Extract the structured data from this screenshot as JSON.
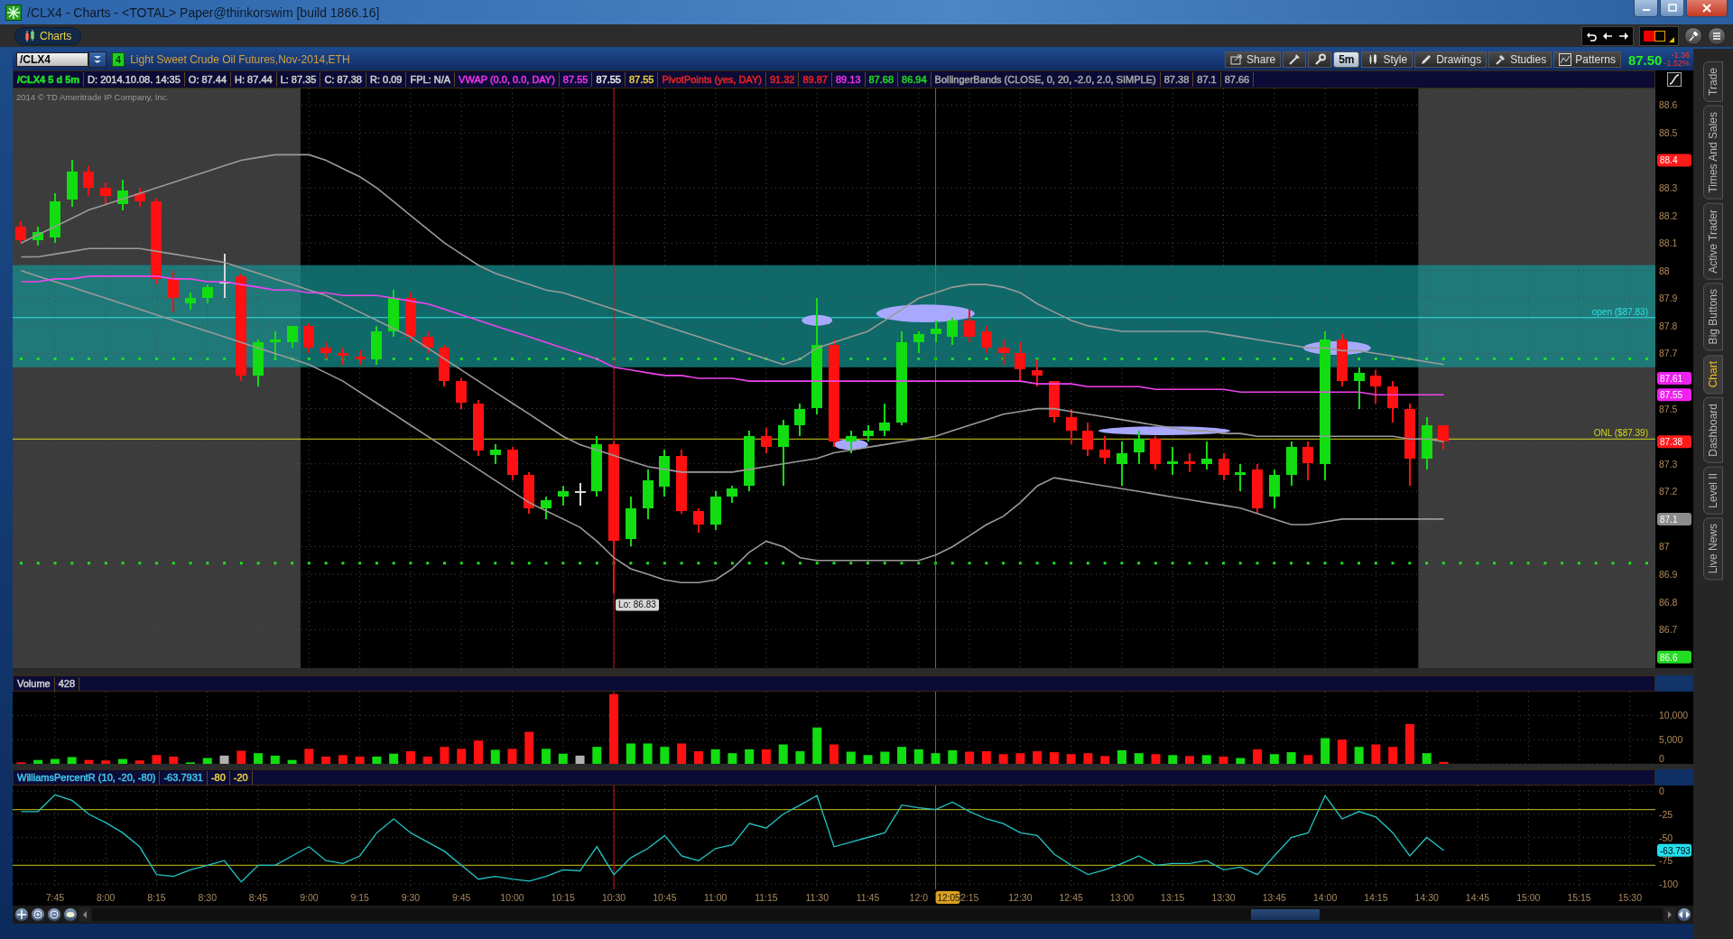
{
  "window": {
    "title": "/CLX4 - Charts - <TOTAL> Paper@thinkorswim [build 1866.16]"
  },
  "app_tabs": [
    {
      "label": "Charts",
      "selected": true
    }
  ],
  "symbol_bar": {
    "symbol": "/CLX4",
    "badge": "4",
    "description": "Light Sweet Crude Oil Futures,Nov-2014,ETH",
    "last_price": "87.50",
    "change": "-1.36",
    "change_percent": "-1.52%",
    "toolbar": [
      {
        "kind": "button",
        "label": "Share"
      },
      {
        "kind": "icon"
      },
      {
        "kind": "icon"
      },
      {
        "kind": "interval",
        "label": "5m"
      },
      {
        "kind": "button",
        "label": "Style"
      },
      {
        "kind": "button",
        "label": "Drawings"
      },
      {
        "kind": "button",
        "label": "Studies"
      },
      {
        "kind": "button",
        "label": "Patterns"
      }
    ]
  },
  "info_bar": {
    "cells": [
      {
        "text": "/CLX4 5 d 5m",
        "color": "#22dd22"
      },
      {
        "text": "D: 2014.10.08. 14:35",
        "color": "#d0d0d0"
      },
      {
        "text": "O: 87.44",
        "color": "#d0d0d0"
      },
      {
        "text": "H: 87.44",
        "color": "#d0d0d0"
      },
      {
        "text": "L: 87.35",
        "color": "#d0d0d0"
      },
      {
        "text": "C: 87.38",
        "color": "#d0d0d0"
      },
      {
        "text": "R: 0.09",
        "color": "#d0d0d0"
      },
      {
        "text": "FPL: N/A",
        "color": "#d0d0d0"
      },
      {
        "text": "VWAP (0.0, 0.0, DAY)",
        "color": "#ee33ee"
      },
      {
        "text": "87.55",
        "color": "#ee33ee"
      },
      {
        "text": "87.55",
        "color": "#e8e8e8"
      },
      {
        "text": "87.55",
        "color": "#e8d040"
      },
      {
        "text": "PivotPoints (yes, DAY)",
        "color": "#ee2222"
      },
      {
        "text": "91.32",
        "color": "#ee2222"
      },
      {
        "text": "89.87",
        "color": "#ee2222"
      },
      {
        "text": "89.13",
        "color": "#ee33ee"
      },
      {
        "text": "87.68",
        "color": "#22dd22"
      },
      {
        "text": "86.94",
        "color": "#22dd22"
      },
      {
        "text": "BollingerBands (CLOSE, 0, 20, -2.0, 2.0, SIMPLE)",
        "color": "#a8a8a8"
      },
      {
        "text": "87.38",
        "color": "#a8a8a8"
      },
      {
        "text": "87.1",
        "color": "#a8a8a8"
      },
      {
        "text": "87.66",
        "color": "#a8a8a8"
      }
    ]
  },
  "price_pane": {
    "copyright": "2014 © TD Ameritrade IP Company, Inc.",
    "extended_hours_shaded": true,
    "drawings": [
      {
        "kind": "ellipse"
      },
      {
        "kind": "ellipse"
      },
      {
        "kind": "ellipse"
      },
      {
        "kind": "ellipse"
      },
      {
        "kind": "ellipse"
      }
    ],
    "axis_tags": [
      {
        "label": "88.4",
        "color": "#ff1a1a"
      },
      {
        "label": "87.61",
        "color": "#ee22ee"
      },
      {
        "label": "87.55",
        "color": "#ee22ee"
      },
      {
        "label": "87.38",
        "color": "#ff1a1a"
      },
      {
        "label": "87.1",
        "color": "#8c8c8c"
      },
      {
        "label": "86.6",
        "color": "#22dd22"
      }
    ],
    "chart_data": {
      "type": "candlestick",
      "grid": true,
      "ylim": [
        86.56,
        88.66
      ],
      "yticks": [
        88.6,
        88.5,
        88.3,
        88.2,
        88.1,
        88,
        87.9,
        87.8,
        87.7,
        87.5,
        87.3,
        87.2,
        87,
        86.9,
        86.8,
        86.7
      ],
      "categories": [
        null,
        null,
        null,
        null,
        null,
        null,
        null,
        null,
        null,
        null,
        null,
        null,
        null,
        null,
        null,
        null,
        null,
        null,
        null,
        null,
        null,
        null,
        null,
        null,
        null,
        null,
        null,
        null,
        null,
        null,
        null,
        null,
        null,
        null,
        null,
        null,
        null,
        null,
        null,
        null,
        null,
        null,
        null,
        null,
        null,
        null,
        null,
        null,
        null,
        null,
        null,
        null,
        null,
        null,
        null,
        null,
        null,
        null,
        null,
        null,
        null,
        null,
        null,
        null,
        null,
        null,
        null,
        null,
        null,
        null,
        null,
        null,
        null,
        null,
        null,
        null,
        null,
        null,
        null,
        null,
        null,
        null,
        null,
        null,
        null,
        null,
        null,
        null,
        null,
        null,
        null,
        null,
        null,
        null,
        null,
        null,
        null
      ],
      "ohlc": [
        [
          88.16,
          88.18,
          88.1,
          88.11
        ],
        [
          88.11,
          88.16,
          88.09,
          88.14
        ],
        [
          88.12,
          88.28,
          88.1,
          88.25
        ],
        [
          88.26,
          88.4,
          88.23,
          88.36
        ],
        [
          88.36,
          88.38,
          88.27,
          88.3
        ],
        [
          88.3,
          88.32,
          88.24,
          88.27
        ],
        [
          88.24,
          88.33,
          88.22,
          88.29
        ],
        [
          88.28,
          88.3,
          88.23,
          88.25
        ],
        [
          88.25,
          88.26,
          87.95,
          87.97
        ],
        [
          87.97,
          88.0,
          87.85,
          87.9
        ],
        [
          87.88,
          87.92,
          87.86,
          87.9
        ],
        [
          87.9,
          87.95,
          87.88,
          87.94
        ],
        [
          87.96,
          88.06,
          87.9,
          87.96
        ],
        [
          87.98,
          87.99,
          87.6,
          87.62
        ],
        [
          87.62,
          87.75,
          87.58,
          87.74
        ],
        [
          87.74,
          87.78,
          87.68,
          87.75
        ],
        [
          87.74,
          87.8,
          87.72,
          87.8
        ],
        [
          87.8,
          87.81,
          87.7,
          87.72
        ],
        [
          87.72,
          87.74,
          87.68,
          87.7
        ],
        [
          87.7,
          87.72,
          87.66,
          87.69
        ],
        [
          87.69,
          87.71,
          87.66,
          87.68
        ],
        [
          87.68,
          87.8,
          87.66,
          87.78
        ],
        [
          87.78,
          87.93,
          87.76,
          87.9
        ],
        [
          87.9,
          87.92,
          87.74,
          87.76
        ],
        [
          87.76,
          87.78,
          87.7,
          87.72
        ],
        [
          87.72,
          87.73,
          87.58,
          87.6
        ],
        [
          87.6,
          87.61,
          87.5,
          87.52
        ],
        [
          87.52,
          87.53,
          87.33,
          87.35
        ],
        [
          87.33,
          87.37,
          87.3,
          87.35
        ],
        [
          87.35,
          87.36,
          87.24,
          87.26
        ],
        [
          87.26,
          87.27,
          87.12,
          87.14
        ],
        [
          87.14,
          87.18,
          87.1,
          87.17
        ],
        [
          87.18,
          87.22,
          87.15,
          87.2
        ],
        [
          87.2,
          87.23,
          87.15,
          87.2
        ],
        [
          87.2,
          87.4,
          87.18,
          87.37
        ],
        [
          87.37,
          87.38,
          86.83,
          87.02
        ],
        [
          87.03,
          87.18,
          87.0,
          87.14
        ],
        [
          87.14,
          87.28,
          87.1,
          87.24
        ],
        [
          87.22,
          87.35,
          87.18,
          87.33
        ],
        [
          87.33,
          87.35,
          87.12,
          87.13
        ],
        [
          87.13,
          87.14,
          87.05,
          87.08
        ],
        [
          87.08,
          87.2,
          87.06,
          87.18
        ],
        [
          87.18,
          87.22,
          87.16,
          87.21
        ],
        [
          87.22,
          87.42,
          87.2,
          87.4
        ],
        [
          87.4,
          87.43,
          87.34,
          87.36
        ],
        [
          87.36,
          87.46,
          87.22,
          87.44
        ],
        [
          87.44,
          87.52,
          87.4,
          87.5
        ],
        [
          87.5,
          87.9,
          87.48,
          87.73
        ],
        [
          87.73,
          87.75,
          87.36,
          87.38
        ],
        [
          87.38,
          87.42,
          87.34,
          87.4
        ],
        [
          87.4,
          87.44,
          87.38,
          87.42
        ],
        [
          87.42,
          87.52,
          87.4,
          87.45
        ],
        [
          87.45,
          87.78,
          87.44,
          87.74
        ],
        [
          87.74,
          87.78,
          87.7,
          87.77
        ],
        [
          87.77,
          87.82,
          87.74,
          87.79
        ],
        [
          87.76,
          87.83,
          87.73,
          87.82
        ],
        [
          87.82,
          87.86,
          87.74,
          87.76
        ],
        [
          87.78,
          87.8,
          87.7,
          87.72
        ],
        [
          87.72,
          87.75,
          87.66,
          87.7
        ],
        [
          87.7,
          87.74,
          87.6,
          87.64
        ],
        [
          87.64,
          87.68,
          87.58,
          87.62
        ],
        [
          87.6,
          87.6,
          87.45,
          87.47
        ],
        [
          87.47,
          87.5,
          87.37,
          87.42
        ],
        [
          87.42,
          87.45,
          87.33,
          87.35
        ],
        [
          87.35,
          87.4,
          87.3,
          87.32
        ],
        [
          87.3,
          87.38,
          87.22,
          87.34
        ],
        [
          87.34,
          87.42,
          87.3,
          87.39
        ],
        [
          87.39,
          87.4,
          87.28,
          87.3
        ],
        [
          87.3,
          87.36,
          87.26,
          87.31
        ],
        [
          87.31,
          87.34,
          87.27,
          87.3
        ],
        [
          87.3,
          87.38,
          87.28,
          87.32
        ],
        [
          87.32,
          87.34,
          87.24,
          87.26
        ],
        [
          87.26,
          87.3,
          87.2,
          87.27
        ],
        [
          87.28,
          87.3,
          87.12,
          87.14
        ],
        [
          87.18,
          87.28,
          87.14,
          87.26
        ],
        [
          87.26,
          87.38,
          87.22,
          87.36
        ],
        [
          87.36,
          87.38,
          87.24,
          87.3
        ],
        [
          87.3,
          87.78,
          87.24,
          87.75
        ],
        [
          87.75,
          87.77,
          87.58,
          87.6
        ],
        [
          87.6,
          87.65,
          87.5,
          87.63
        ],
        [
          87.62,
          87.64,
          87.52,
          87.58
        ],
        [
          87.58,
          87.6,
          87.45,
          87.5
        ],
        [
          87.5,
          87.52,
          87.22,
          87.32
        ],
        [
          87.32,
          87.47,
          87.28,
          87.44
        ],
        [
          87.44,
          87.44,
          87.35,
          87.38
        ],
        null,
        null,
        null,
        null,
        null,
        null,
        null,
        null,
        null,
        null,
        null,
        null
      ],
      "series": [
        {
          "type": "line",
          "color": "#ee44ee",
          "values": [
            87.96,
            87.96,
            87.97,
            87.97,
            87.98,
            87.98,
            87.98,
            87.98,
            87.98,
            87.97,
            87.97,
            87.96,
            87.96,
            87.95,
            87.94,
            87.93,
            87.93,
            87.92,
            87.92,
            87.91,
            87.91,
            87.91,
            87.9,
            87.89,
            87.88,
            87.86,
            87.84,
            87.82,
            87.8,
            87.78,
            87.76,
            87.74,
            87.72,
            87.7,
            87.68,
            87.65,
            87.64,
            87.63,
            87.62,
            87.62,
            87.61,
            87.61,
            87.61,
            87.6,
            87.6,
            87.6,
            87.6,
            87.6,
            87.6,
            87.6,
            87.6,
            87.6,
            87.6,
            87.6,
            87.6,
            87.6,
            87.6,
            87.6,
            87.6,
            87.6,
            87.59,
            87.59,
            87.59,
            87.58,
            87.58,
            87.58,
            87.58,
            87.57,
            87.57,
            87.57,
            87.57,
            87.57,
            87.56,
            87.56,
            87.56,
            87.56,
            87.56,
            87.56,
            87.56,
            87.56,
            87.55,
            87.55,
            87.55,
            87.55,
            87.55,
            null,
            null,
            null,
            null,
            null,
            null,
            null,
            null,
            null,
            null,
            null,
            null
          ]
        },
        {
          "type": "line",
          "color": "#9a9a9a",
          "values": [
            88.1,
            88.13,
            88.16,
            88.19,
            88.22,
            88.24,
            88.26,
            88.28,
            88.3,
            88.32,
            88.34,
            88.36,
            88.38,
            88.4,
            88.41,
            88.42,
            88.42,
            88.42,
            88.4,
            88.37,
            88.34,
            88.3,
            88.25,
            88.2,
            88.15,
            88.1,
            88.06,
            88.02,
            87.99,
            87.97,
            87.95,
            87.93,
            87.92,
            87.9,
            87.88,
            87.86,
            87.84,
            87.82,
            87.8,
            87.78,
            87.76,
            87.74,
            87.72,
            87.7,
            87.68,
            87.66,
            87.68,
            87.72,
            87.74,
            87.76,
            87.78,
            87.82,
            87.86,
            87.9,
            87.92,
            87.94,
            87.95,
            87.95,
            87.94,
            87.92,
            87.88,
            87.85,
            87.82,
            87.8,
            87.79,
            87.78,
            87.78,
            87.78,
            87.78,
            87.78,
            87.78,
            87.77,
            87.76,
            87.75,
            87.74,
            87.73,
            87.72,
            87.72,
            87.71,
            87.71,
            87.7,
            87.69,
            87.68,
            87.67,
            87.66,
            null,
            null,
            null,
            null,
            null,
            null,
            null,
            null,
            null,
            null,
            null,
            null
          ]
        },
        {
          "type": "line",
          "color": "#9a9a9a",
          "values": [
            88.05,
            88.05,
            88.06,
            88.07,
            88.08,
            88.08,
            88.08,
            88.08,
            88.07,
            88.06,
            88.05,
            88.04,
            88.03,
            88.01,
            87.99,
            87.97,
            87.95,
            87.93,
            87.91,
            87.88,
            87.85,
            87.82,
            87.79,
            87.76,
            87.72,
            87.68,
            87.64,
            87.6,
            87.56,
            87.52,
            87.48,
            87.44,
            87.4,
            87.37,
            87.35,
            87.33,
            87.31,
            87.29,
            87.28,
            87.27,
            87.27,
            87.27,
            87.27,
            87.28,
            87.29,
            87.3,
            87.31,
            87.32,
            87.34,
            87.35,
            87.36,
            87.37,
            87.38,
            87.39,
            87.4,
            87.42,
            87.44,
            87.46,
            87.48,
            87.49,
            87.5,
            87.5,
            87.49,
            87.48,
            87.47,
            87.46,
            87.45,
            87.44,
            87.43,
            87.42,
            87.42,
            87.41,
            87.41,
            87.4,
            87.4,
            87.4,
            87.4,
            87.4,
            87.4,
            87.4,
            87.4,
            87.4,
            87.39,
            87.39,
            87.38,
            null,
            null,
            null,
            null,
            null,
            null,
            null,
            null,
            null,
            null,
            null,
            null
          ]
        },
        {
          "type": "line",
          "color": "#9a9a9a",
          "values": [
            88.0,
            87.98,
            87.96,
            87.94,
            87.92,
            87.9,
            87.88,
            87.86,
            87.84,
            87.82,
            87.8,
            87.78,
            87.76,
            87.74,
            87.72,
            87.7,
            87.68,
            87.66,
            87.63,
            87.6,
            87.56,
            87.52,
            87.48,
            87.44,
            87.4,
            87.36,
            87.32,
            87.28,
            87.24,
            87.2,
            87.16,
            87.13,
            87.1,
            87.07,
            87.02,
            86.96,
            86.92,
            86.9,
            86.88,
            86.87,
            86.87,
            86.88,
            86.92,
            86.98,
            87.02,
            87.0,
            86.96,
            86.95,
            86.95,
            86.95,
            86.95,
            86.95,
            86.95,
            86.95,
            86.97,
            87.0,
            87.04,
            87.08,
            87.11,
            87.16,
            87.22,
            87.25,
            87.24,
            87.23,
            87.22,
            87.21,
            87.2,
            87.19,
            87.18,
            87.17,
            87.16,
            87.15,
            87.14,
            87.12,
            87.1,
            87.08,
            87.08,
            87.09,
            87.1,
            87.1,
            87.1,
            87.1,
            87.1,
            87.1,
            87.1,
            null,
            null,
            null,
            null,
            null,
            null,
            null,
            null,
            null,
            null,
            null,
            null
          ]
        }
      ],
      "bands": [
        {
          "axis": "y",
          "from": 87.65,
          "to": 88.02,
          "color": "#169292"
        }
      ],
      "ref_lines": [
        {
          "axis": "y",
          "value": 87.83,
          "label": "open ($87.83)",
          "color": "#33e0e0"
        },
        {
          "axis": "y",
          "value": 87.39,
          "label": "ONL ($87.39)",
          "color": "#d8d820"
        },
        {
          "axis": "y",
          "value": 87.68,
          "color": "#22dd22"
        },
        {
          "axis": "y",
          "value": 86.94,
          "color": "#22dd22"
        }
      ],
      "annotations": [
        "Lo: 86.83"
      ]
    }
  },
  "volume_pane": {
    "header": [
      {
        "text": "Volume",
        "color": "#d0d0d0"
      },
      {
        "text": "428",
        "color": "#d0d0d0"
      }
    ],
    "chart_data": {
      "type": "bar",
      "grid": true,
      "ylim": [
        0,
        14900
      ],
      "yticks": [
        {
          "value": 10000,
          "label": "10,000"
        },
        {
          "value": 5000,
          "label": "5,000"
        },
        {
          "value": 0,
          "label": "0"
        }
      ],
      "categories": [
        null,
        null,
        null,
        null,
        null,
        null,
        null,
        null,
        null,
        null,
        null,
        null,
        null,
        null,
        null,
        null,
        null,
        null,
        null,
        null,
        null,
        null,
        null,
        null,
        null,
        null,
        null,
        null,
        null,
        null,
        null,
        null,
        null,
        null,
        null,
        null,
        null,
        null,
        null,
        null,
        null,
        null,
        null,
        null,
        null,
        null,
        null,
        null,
        null,
        null,
        null,
        null,
        null,
        null,
        null,
        null,
        null,
        null,
        null,
        null,
        null,
        null,
        null,
        null,
        null,
        null,
        null,
        null,
        null,
        null,
        null,
        null,
        null,
        null,
        null,
        null,
        null,
        null,
        null,
        null,
        null,
        null,
        null,
        null,
        null,
        null,
        null,
        null,
        null,
        null,
        null,
        null,
        null,
        null,
        null,
        null,
        null
      ],
      "series": [
        {
          "values": [
            300,
            800,
            1000,
            1400,
            800,
            700,
            1000,
            700,
            1800,
            1500,
            300,
            1200,
            1700,
            2700,
            2200,
            1700,
            800,
            3100,
            1500,
            1800,
            1500,
            1500,
            2100,
            2600,
            1500,
            3500,
            3100,
            4800,
            2900,
            3100,
            6600,
            3100,
            2100,
            1700,
            3500,
            14400,
            4200,
            4200,
            3500,
            4200,
            2600,
            3000,
            2200,
            3000,
            3000,
            4000,
            2600,
            7500,
            4000,
            2500,
            1800,
            2500,
            3500,
            3000,
            2200,
            2800,
            2500,
            2600,
            2000,
            2200,
            2600,
            2400,
            2000,
            2200,
            1600,
            2800,
            2200,
            2000,
            1800,
            1600,
            1800,
            1500,
            1200,
            3000,
            2000,
            2400,
            1800,
            5300,
            5000,
            3500,
            4000,
            3500,
            8200,
            2200,
            400,
            null,
            null,
            null,
            null,
            null,
            null,
            null,
            null,
            null,
            null,
            null,
            null
          ]
        }
      ]
    }
  },
  "williams_pane": {
    "header": [
      {
        "text": "WilliamsPercentR (10, -20, -80)",
        "color": "#40c8f0"
      },
      {
        "text": "-63.7931",
        "color": "#40c8f0"
      },
      {
        "text": "-80",
        "color": "#e8d040"
      },
      {
        "text": "-20",
        "color": "#e8d040"
      }
    ],
    "axis_tags": [
      {
        "label": "-63.793",
        "color": "#22e0f0"
      }
    ],
    "cursor_time": "12:05",
    "chart_data": {
      "type": "line",
      "grid": true,
      "ylim": [
        -106,
        6
      ],
      "yticks": [
        0,
        -25,
        -50,
        -75,
        -100
      ],
      "categories": [
        null,
        null,
        "7:45",
        null,
        null,
        "8:00",
        null,
        null,
        "8:15",
        null,
        null,
        "8:30",
        null,
        null,
        "8:45",
        null,
        null,
        "9:00",
        null,
        null,
        "9:15",
        null,
        null,
        "9:30",
        null,
        null,
        "9:45",
        null,
        null,
        "10:00",
        null,
        null,
        "10:15",
        null,
        null,
        "10:30",
        null,
        null,
        "10:45",
        null,
        null,
        "11:00",
        null,
        null,
        "11:15",
        null,
        null,
        "11:30",
        null,
        null,
        "11:45",
        null,
        null,
        "12:0",
        null,
        null,
        "2:15",
        null,
        null,
        "12:30",
        null,
        null,
        "12:45",
        null,
        null,
        "13:00",
        null,
        null,
        "13:15",
        null,
        null,
        "13:30",
        null,
        null,
        "13:45",
        null,
        null,
        "14:00",
        null,
        null,
        "14:15",
        null,
        null,
        "14:30",
        null,
        null,
        "14:45",
        null,
        null,
        "15:00",
        null,
        null,
        "15:15",
        null,
        null,
        "15:30",
        null
      ],
      "series": [
        {
          "color": "#22c4c4",
          "values": [
            -22,
            -22,
            -4,
            -10,
            -25,
            -34,
            -45,
            -60,
            -90,
            -92,
            -85,
            -80,
            -75,
            -98,
            -80,
            -80,
            -70,
            -60,
            -75,
            -78,
            -70,
            -45,
            -30,
            -45,
            -55,
            -65,
            -80,
            -95,
            -92,
            -95,
            -97,
            -92,
            -85,
            -86,
            -60,
            -90,
            -72,
            -62,
            -48,
            -70,
            -75,
            -62,
            -58,
            -35,
            -40,
            -25,
            -15,
            -5,
            -60,
            -55,
            -50,
            -45,
            -15,
            -18,
            -20,
            -12,
            -22,
            -30,
            -35,
            -45,
            -48,
            -68,
            -80,
            -90,
            -85,
            -78,
            -70,
            -80,
            -78,
            -78,
            -75,
            -85,
            -82,
            -90,
            -70,
            -50,
            -45,
            -5,
            -30,
            -22,
            -28,
            -45,
            -70,
            -50,
            -64,
            null,
            null,
            null,
            null,
            null,
            null,
            null,
            null,
            null,
            null,
            null,
            null
          ]
        }
      ],
      "ref_lines": [
        {
          "axis": "y",
          "value": -20,
          "color": "#c8c820"
        },
        {
          "axis": "y",
          "value": -80,
          "color": "#c8c820"
        }
      ]
    }
  },
  "side_tabs": [
    {
      "label": "Trade",
      "selected": false
    },
    {
      "label": "Times And Sales",
      "selected": false
    },
    {
      "label": "Active Trader",
      "selected": false
    },
    {
      "label": "Big Buttons",
      "selected": false
    },
    {
      "label": "Chart",
      "selected": true
    },
    {
      "label": "Dashboard",
      "selected": false
    },
    {
      "label": "Level II",
      "selected": false
    },
    {
      "label": "Live News",
      "selected": false
    }
  ]
}
